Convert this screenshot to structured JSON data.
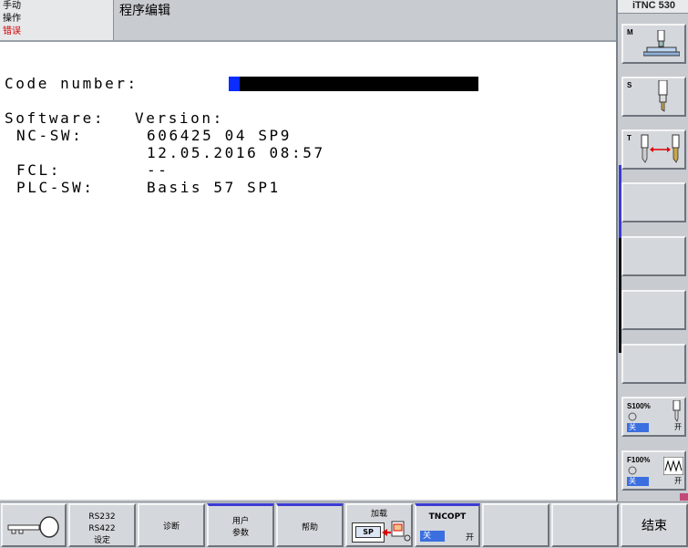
{
  "mode": {
    "line1": "手动",
    "line2": "操作",
    "line3": "错误"
  },
  "program_title": "程序编辑",
  "brand": "iTNC 530",
  "main": {
    "code_label": "Code number:",
    "software_label": "Software:",
    "version_label": "Version:",
    "nc_label": "NC-SW:",
    "nc_version": "606425 04 SP9",
    "nc_date": "12.05.2016 08:57",
    "fcl_label": "FCL:",
    "fcl_value": "--",
    "plc_label": "PLC-SW:",
    "plc_value": "Basis 57 SP1"
  },
  "side_keys": {
    "m_label": "M",
    "s_label": "S",
    "t_label": "T",
    "s_override": {
      "label": "S100%",
      "off": "关",
      "on": "开"
    },
    "f_override": {
      "label": "F100%",
      "off": "关",
      "on": "开"
    }
  },
  "bottom_keys": {
    "rs_line1": "RS232",
    "rs_line2": "RS422",
    "rs_line3": "设定",
    "diag": "诊断",
    "user_line1": "用户",
    "user_line2": "参数",
    "help": "帮助",
    "load_label": "加载",
    "load_sp": "SP",
    "tncopt_label": "TNCOPT",
    "tncopt_off": "关",
    "tncopt_on": "开",
    "end": "结束"
  },
  "colors": {
    "cursor": "#0a2cff",
    "error_text": "#d00000",
    "toggle_active": "#3b6fe0"
  }
}
